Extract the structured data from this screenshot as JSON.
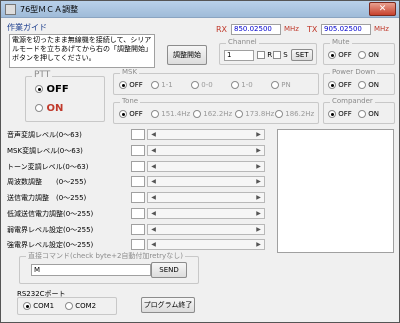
{
  "window": {
    "title": "76型ＭＣＡ調整",
    "close_label": "✕"
  },
  "guide": {
    "heading": "作業ガイド",
    "text": "電源を切ったまま無線機を接続して、シリアルモードを立ちあげてから右の「調整開始」ボタンを押してください。"
  },
  "start_button": "調整開始",
  "rx": {
    "label": "RX",
    "value": "850.02500",
    "unit": "MHz"
  },
  "tx": {
    "label": "TX",
    "value": "905.02500",
    "unit": "MHz"
  },
  "channel": {
    "label": "Channel",
    "value": "1",
    "r_label": "R",
    "s_label": "S",
    "set_label": "SET"
  },
  "mute": {
    "label": "Mute",
    "options": [
      "OFF",
      "ON"
    ],
    "selected": "OFF"
  },
  "ptt": {
    "label": "PTT",
    "options": [
      "OFF",
      "ON"
    ],
    "selected": "OFF"
  },
  "msk": {
    "label": "MSK",
    "options": [
      "OFF",
      "1-1",
      "0-0",
      "1-0",
      "PN"
    ],
    "selected": "OFF"
  },
  "power_down": {
    "label": "Power Down",
    "options": [
      "OFF",
      "ON"
    ],
    "selected": "OFF"
  },
  "tone": {
    "label": "Tone",
    "options": [
      "OFF",
      "151.4Hz",
      "162.2Hz",
      "173.8Hz",
      "186.2Hz"
    ],
    "selected": "OFF"
  },
  "compander": {
    "label": "Compander",
    "options": [
      "OFF",
      "ON"
    ],
    "selected": "OFF"
  },
  "sliders": [
    {
      "label": "音声変調レベル(0〜63)"
    },
    {
      "label": "MSK変調レベル(0〜63)"
    },
    {
      "label": "トーン変調レベル(0〜63)"
    },
    {
      "label": "周波数調整　　(0〜255)"
    },
    {
      "label": "送信電力調整　(0〜255)"
    },
    {
      "label": "低減送信電力調整(0〜255)"
    },
    {
      "label": "弱電界レベル設定(0〜255)"
    },
    {
      "label": "強電界レベル設定(0〜255)"
    }
  ],
  "direct": {
    "label": "直接コマンド(check byte+2自動付加retryなし)",
    "value": "M",
    "send_label": "SEND"
  },
  "rs232c": {
    "label": "RS232Cポート",
    "options": [
      "COM1",
      "COM2"
    ],
    "selected": "COM1"
  },
  "exit_button": "プログラム終了",
  "colors": {
    "accent_red": "#c0392b",
    "value_blue": "#0000cc",
    "disabled_gray": "#999999"
  }
}
